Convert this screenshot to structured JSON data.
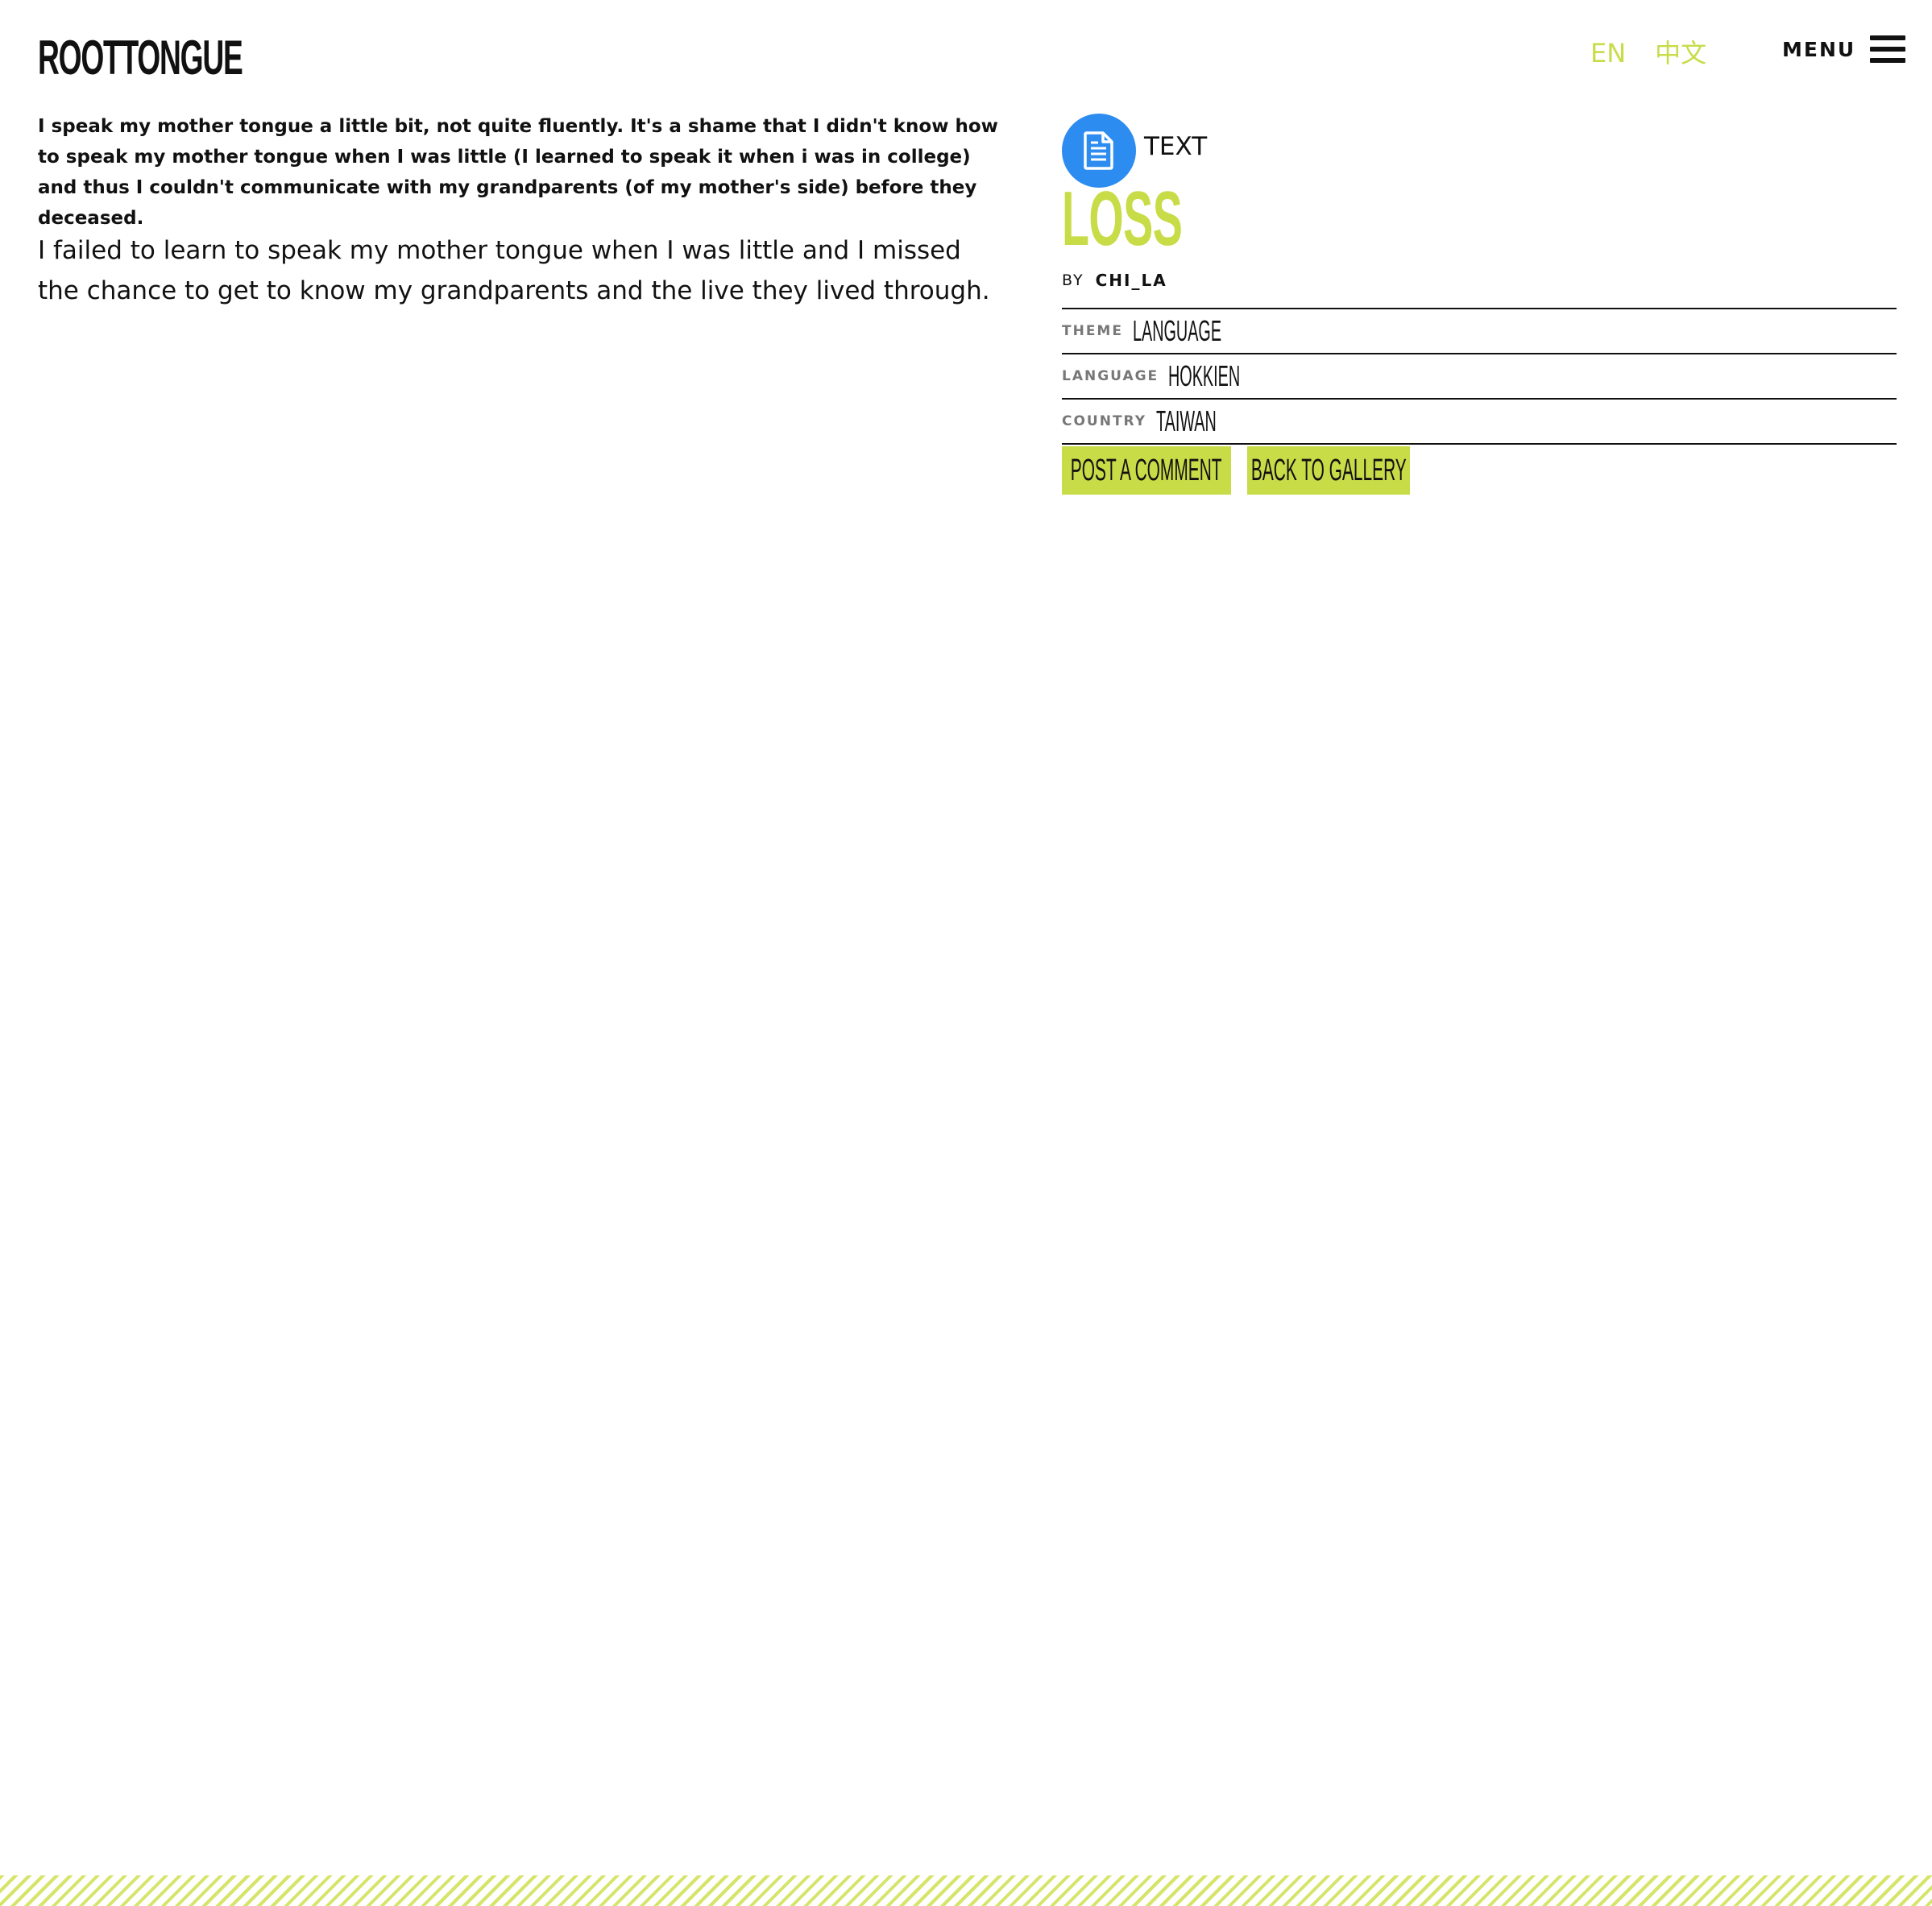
{
  "header": {
    "logo_text": "ROOTTONGUE",
    "languages": [
      "EN",
      "中文"
    ],
    "menu_label": "MENU"
  },
  "content": {
    "intro": "I speak my mother tongue a little bit, not quite fluently. It's a shame that I didn't know how to speak my mother tongue when I was little (I learned to speak it when i was in college) and thus I couldn't communicate with my grandparents (of my mother's side) before they deceased.",
    "story": "I failed to learn to speak my mother tongue when I was little and I missed the chance to get to know my grandparents and the live they lived through."
  },
  "entry": {
    "type_icon": "document-icon",
    "type_label": "TEXT",
    "title": "LOSS",
    "by_label": "BY",
    "author": "CHI_LA",
    "meta": [
      {
        "label": "THEME",
        "value": "LANGUAGE"
      },
      {
        "label": "LANGUAGE",
        "value": "HOKKIEN"
      },
      {
        "label": "COUNTRY",
        "value": "TAIWAN"
      }
    ],
    "actions": {
      "post_comment": "POST A COMMENT",
      "back_to_gallery": "BACK TO GALLERY"
    }
  },
  "colors": {
    "accent": "#c8dc48",
    "icon_bg": "#2d8cf0",
    "text": "#111111",
    "meta_label": "#777777"
  }
}
